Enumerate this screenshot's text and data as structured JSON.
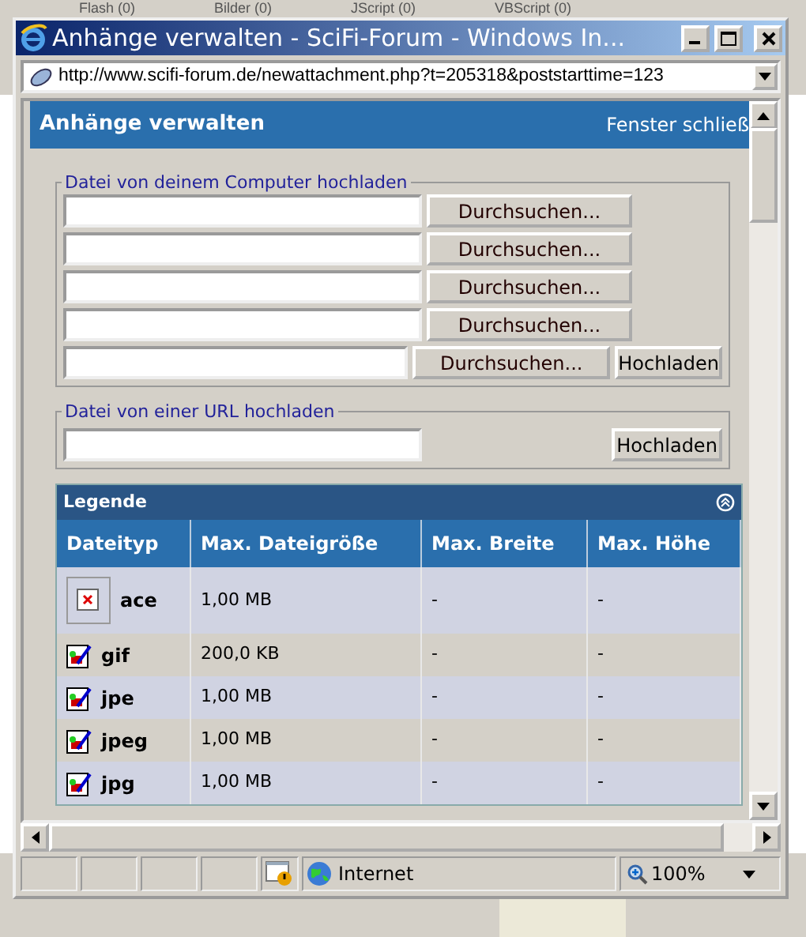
{
  "background_toolbar": [
    {
      "label": "Flash (0)"
    },
    {
      "label": "Bilder (0)"
    },
    {
      "label": "JScript (0)"
    },
    {
      "label": "VBScript (0)"
    }
  ],
  "window": {
    "title": "Anhänge verwalten - SciFi-Forum - Windows In...",
    "address": "http://www.scifi-forum.de/newattachment.php?t=205318&poststarttime=123"
  },
  "page": {
    "title": "Anhänge verwalten",
    "close_link": "Fenster schließ",
    "computer_upload": {
      "legend": "Datei von deinem Computer hochladen",
      "rows": [
        {
          "button": "Durchsuchen..."
        },
        {
          "button": "Durchsuchen..."
        },
        {
          "button": "Durchsuchen..."
        },
        {
          "button": "Durchsuchen..."
        },
        {
          "button": "Durchsuchen..."
        }
      ],
      "submit": "Hochladen"
    },
    "url_upload": {
      "legend": "Datei von einer URL hochladen",
      "submit": "Hochladen"
    },
    "legend_table": {
      "title": "Legende",
      "columns": [
        "Dateityp",
        "Max. Dateigröße",
        "Max. Breite",
        "Max. Höhe"
      ],
      "rows": [
        {
          "kind": "missing",
          "cells": [
            "ace",
            "1,00 MB",
            "-",
            "-"
          ]
        },
        {
          "kind": "image",
          "cells": [
            "gif",
            "200,0 KB",
            "-",
            "-"
          ]
        },
        {
          "kind": "image",
          "cells": [
            "jpe",
            "1,00 MB",
            "-",
            "-"
          ]
        },
        {
          "kind": "image",
          "cells": [
            "jpeg",
            "1,00 MB",
            "-",
            "-"
          ]
        },
        {
          "kind": "image",
          "cells": [
            "jpg",
            "1,00 MB",
            "-",
            "-"
          ]
        }
      ]
    }
  },
  "status_bar": {
    "zone": "Internet",
    "zoom": "100%"
  }
}
